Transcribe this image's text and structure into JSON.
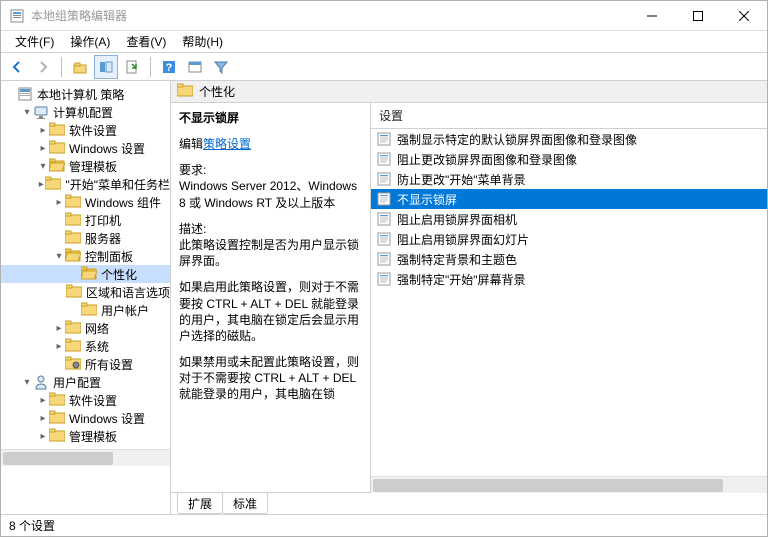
{
  "window": {
    "title": "本地组策略编辑器"
  },
  "menu": {
    "file": "文件(F)",
    "action": "操作(A)",
    "view": "查看(V)",
    "help": "帮助(H)"
  },
  "tree": {
    "root": "本地计算机 策略",
    "computer": "计算机配置",
    "software": "软件设置",
    "windows": "Windows 设置",
    "admin": "管理模板",
    "startmenu": "\"开始\"菜单和任务栏",
    "wincomp": "Windows 组件",
    "printer": "打印机",
    "server": "服务器",
    "cpanel": "控制面板",
    "personal": "个性化",
    "region": "区域和语言选项",
    "useracct": "用户帐户",
    "network": "网络",
    "system": "系统",
    "allsettings": "所有设置",
    "userconf": "用户配置",
    "software2": "软件设置",
    "windows2": "Windows 设置",
    "admin2": "管理模板"
  },
  "path": {
    "current": "个性化"
  },
  "detail": {
    "heading": "不显示锁屏",
    "edit_prefix": "编辑",
    "edit_link": "策略设置",
    "req_label": "要求:",
    "req_text": "Windows Server 2012、Windows 8 或 Windows RT 及以上版本",
    "desc_label": "描述:",
    "desc_text": "此策略设置控制是否为用户显示锁屏界面。",
    "p2": "如果启用此策略设置，则对于不需要按 CTRL + ALT + DEL  就能登录的用户，其电脑在锁定后会显示用户选择的磁贴。",
    "p3": "如果禁用或未配置此策略设置，则对于不需要按 CTRL + ALT + DEL 就能登录的用户，其电脑在锁"
  },
  "list": {
    "header": "设置",
    "items": [
      "强制显示特定的默认锁屏界面图像和登录图像",
      "阻止更改锁屏界面图像和登录图像",
      "防止更改\"开始\"菜单背景",
      "不显示锁屏",
      "阻止启用锁屏界面相机",
      "阻止启用锁屏界面幻灯片",
      "强制特定背景和主题色",
      "强制特定\"开始\"屏幕背景"
    ],
    "selected_index": 3
  },
  "tabs": {
    "extended": "扩展",
    "standard": "标准"
  },
  "status": {
    "text": "8 个设置"
  }
}
